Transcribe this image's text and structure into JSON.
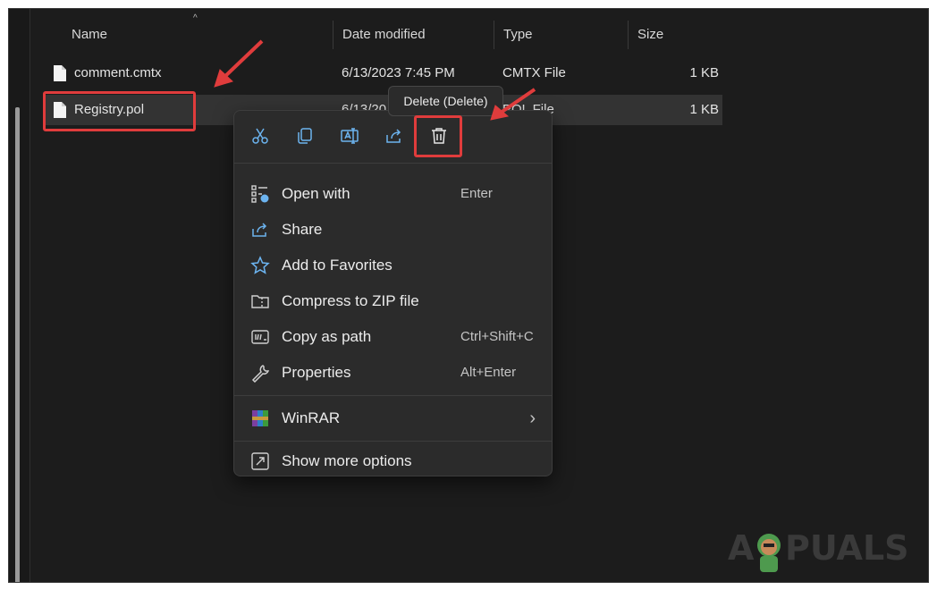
{
  "columns": {
    "name": "Name",
    "date": "Date modified",
    "type": "Type",
    "size": "Size"
  },
  "files": [
    {
      "name": "comment.cmtx",
      "date": "6/13/2023 7:45 PM",
      "type": "CMTX File",
      "size": "1 KB"
    },
    {
      "name": "Registry.pol",
      "date": "6/13/20",
      "type": "POL File",
      "size": "1 KB"
    }
  ],
  "toolbar": {
    "cut_icon": "scissors-icon",
    "copy_icon": "copy-icon",
    "rename_icon": "rename-icon",
    "share_icon": "share-icon",
    "delete_icon": "trash-icon"
  },
  "tooltip": "Delete (Delete)",
  "menu": {
    "open_with": {
      "label": "Open with",
      "shortcut": "Enter"
    },
    "share": {
      "label": "Share"
    },
    "favorites": {
      "label": "Add to Favorites"
    },
    "compress": {
      "label": "Compress to ZIP file"
    },
    "copy_path": {
      "label": "Copy as path",
      "shortcut": "Ctrl+Shift+C"
    },
    "properties": {
      "label": "Properties",
      "shortcut": "Alt+Enter"
    },
    "winrar": {
      "label": "WinRAR"
    },
    "more": {
      "label": "Show more options"
    }
  },
  "watermark": {
    "left": "A",
    "right": "PUALS"
  },
  "colors": {
    "accent": "#6cb4f0",
    "highlight": "#e03c3c",
    "background": "#1c1c1c",
    "menu": "#2b2b2b"
  }
}
